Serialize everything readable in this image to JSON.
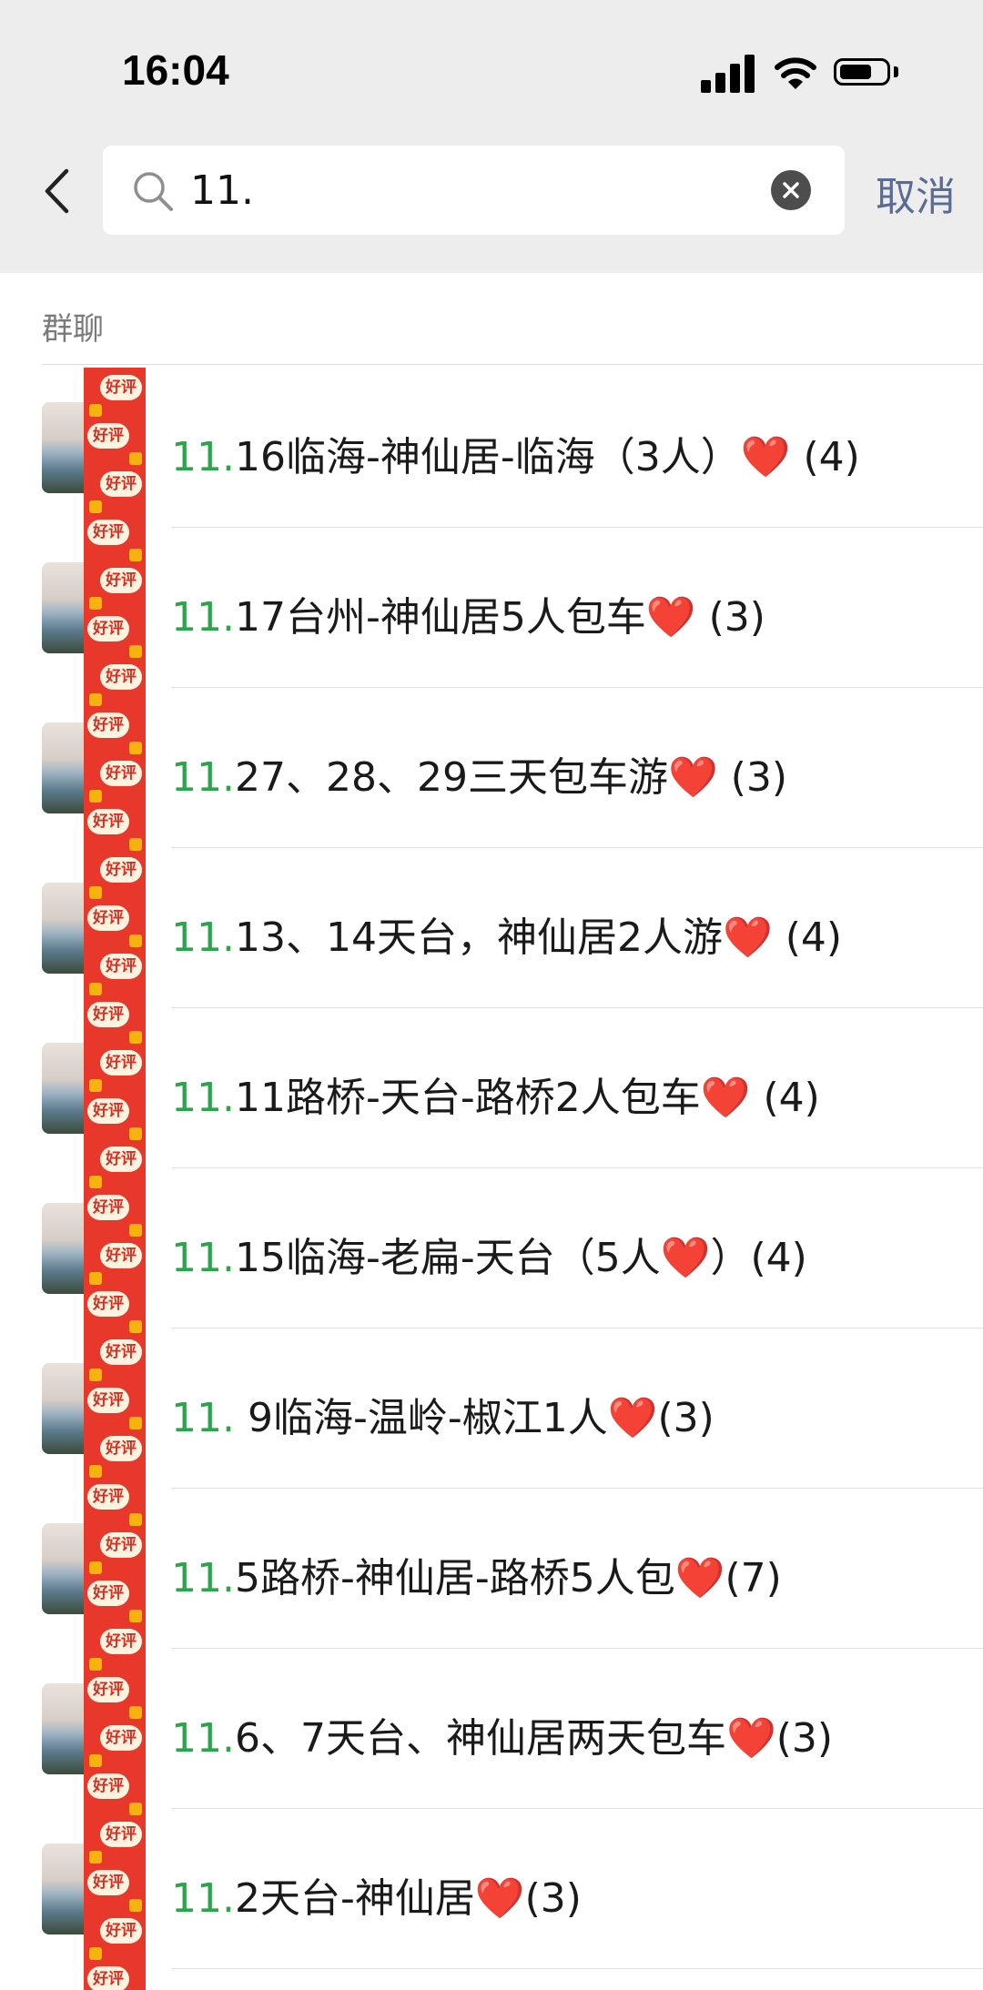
{
  "status_bar": {
    "time": "16:04"
  },
  "search": {
    "query": "11.",
    "cancel_label": "取消"
  },
  "section": {
    "title": "群聊"
  },
  "results": [
    {
      "highlight": "11.",
      "rest": "16临海-神仙居-临海（3人）❤️ (4)"
    },
    {
      "highlight": "11.",
      "rest": "17台州-神仙居5人包车❤️ (3)"
    },
    {
      "highlight": "11.",
      "rest": "27、28、29三天包车游❤️ (3)"
    },
    {
      "highlight": "11.",
      "rest": "13、14天台，神仙居2人游❤️ (4)"
    },
    {
      "highlight": "11.",
      "rest": "11路桥-天台-路桥2人包车❤️ (4)"
    },
    {
      "highlight": "11.",
      "rest": "15临海-老扁-天台（5人❤️）(4)"
    },
    {
      "highlight": "11.",
      "rest": " 9临海-温岭-椒江1人❤️(3)"
    },
    {
      "highlight": "11.",
      "rest": "5路桥-神仙居-路桥5人包❤️(7)"
    },
    {
      "highlight": "11.",
      "rest": "6、7天台、神仙居两天包车❤️(3)"
    },
    {
      "highlight": "11.",
      "rest": "2天台-神仙居❤️(3)"
    }
  ],
  "stickers": {
    "label": "好评"
  },
  "colors": {
    "highlight": "#2aa54a",
    "cancel": "#5a6b95",
    "header_bg": "#ededed",
    "sticker_red": "#e8382b"
  }
}
